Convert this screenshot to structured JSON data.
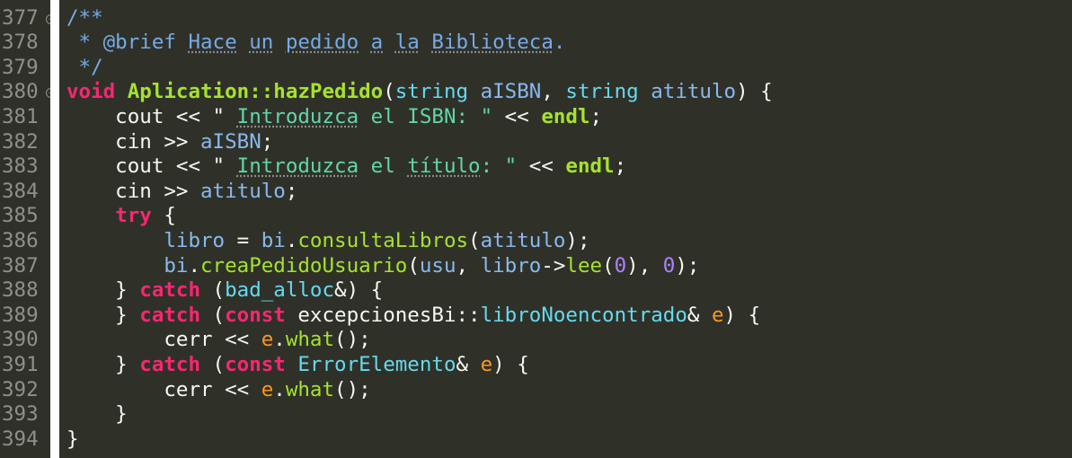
{
  "editor": {
    "lines": [
      {
        "number": "377",
        "fold": true,
        "tokens": [
          {
            "t": "/**",
            "c": "t-comment"
          }
        ]
      },
      {
        "number": "378",
        "fold": false,
        "tokens": [
          {
            "t": " * @brief ",
            "c": "t-comment"
          },
          {
            "t": "Hace",
            "c": "t-commentword"
          },
          {
            "t": " ",
            "c": "t-comment"
          },
          {
            "t": "un",
            "c": "t-commentword"
          },
          {
            "t": " ",
            "c": "t-comment"
          },
          {
            "t": "pedido",
            "c": "t-commentword"
          },
          {
            "t": " ",
            "c": "t-comment"
          },
          {
            "t": "a",
            "c": "t-commentword"
          },
          {
            "t": " ",
            "c": "t-comment"
          },
          {
            "t": "la",
            "c": "t-commentword"
          },
          {
            "t": " ",
            "c": "t-comment"
          },
          {
            "t": "Biblioteca",
            "c": "t-commentword"
          },
          {
            "t": ".",
            "c": "t-comment"
          }
        ]
      },
      {
        "number": "379",
        "fold": false,
        "tokens": [
          {
            "t": " */",
            "c": "t-comment"
          }
        ]
      },
      {
        "number": "380",
        "fold": true,
        "tokens": [
          {
            "t": "void",
            "c": "t-bold-keyword"
          },
          {
            "t": " ",
            "c": "t-plain"
          },
          {
            "t": "Aplication::hazPedido",
            "c": "t-bold-func"
          },
          {
            "t": "(",
            "c": "t-plain"
          },
          {
            "t": "string",
            "c": "t-type"
          },
          {
            "t": " ",
            "c": "t-plain"
          },
          {
            "t": "aISBN",
            "c": "t-ident"
          },
          {
            "t": ", ",
            "c": "t-plain"
          },
          {
            "t": "string",
            "c": "t-type"
          },
          {
            "t": " ",
            "c": "t-plain"
          },
          {
            "t": "atitulo",
            "c": "t-ident"
          },
          {
            "t": ") {",
            "c": "t-plain"
          }
        ]
      },
      {
        "number": "381",
        "fold": false,
        "tokens": [
          {
            "t": "    cout << \" ",
            "c": "t-plain"
          },
          {
            "t": "Introduzca",
            "c": "t-strword"
          },
          {
            "t": " el ISBN: \"",
            "c": "t-string"
          },
          {
            "t": " << ",
            "c": "t-plain"
          },
          {
            "t": "endl",
            "c": "t-bold-func"
          },
          {
            "t": ";",
            "c": "t-plain"
          }
        ]
      },
      {
        "number": "382",
        "fold": false,
        "tokens": [
          {
            "t": "    cin >> ",
            "c": "t-plain"
          },
          {
            "t": "aISBN",
            "c": "t-ident"
          },
          {
            "t": ";",
            "c": "t-plain"
          }
        ]
      },
      {
        "number": "383",
        "fold": false,
        "tokens": [
          {
            "t": "    cout << \" ",
            "c": "t-plain"
          },
          {
            "t": "Introduzca",
            "c": "t-strword"
          },
          {
            "t": " el ",
            "c": "t-string"
          },
          {
            "t": "título",
            "c": "t-strword"
          },
          {
            "t": ": \"",
            "c": "t-string"
          },
          {
            "t": " << ",
            "c": "t-plain"
          },
          {
            "t": "endl",
            "c": "t-bold-func"
          },
          {
            "t": ";",
            "c": "t-plain"
          }
        ]
      },
      {
        "number": "384",
        "fold": false,
        "tokens": [
          {
            "t": "    cin >> ",
            "c": "t-plain"
          },
          {
            "t": "atitulo",
            "c": "t-ident"
          },
          {
            "t": ";",
            "c": "t-plain"
          }
        ]
      },
      {
        "number": "385",
        "fold": false,
        "tokens": [
          {
            "t": "    ",
            "c": "t-plain"
          },
          {
            "t": "try",
            "c": "t-bold-keyword"
          },
          {
            "t": " {",
            "c": "t-plain"
          }
        ]
      },
      {
        "number": "386",
        "fold": false,
        "tokens": [
          {
            "t": "        ",
            "c": "t-plain"
          },
          {
            "t": "libro",
            "c": "t-ident"
          },
          {
            "t": " = ",
            "c": "t-plain"
          },
          {
            "t": "bi",
            "c": "t-ident"
          },
          {
            "t": ".",
            "c": "t-plain"
          },
          {
            "t": "consultaLibros",
            "c": "t-method"
          },
          {
            "t": "(",
            "c": "t-plain"
          },
          {
            "t": "atitulo",
            "c": "t-ident"
          },
          {
            "t": ");",
            "c": "t-plain"
          }
        ]
      },
      {
        "number": "387",
        "fold": false,
        "tokens": [
          {
            "t": "        ",
            "c": "t-plain"
          },
          {
            "t": "bi",
            "c": "t-ident"
          },
          {
            "t": ".",
            "c": "t-plain"
          },
          {
            "t": "creaPedidoUsuario",
            "c": "t-method"
          },
          {
            "t": "(",
            "c": "t-plain"
          },
          {
            "t": "usu",
            "c": "t-ident"
          },
          {
            "t": ", ",
            "c": "t-plain"
          },
          {
            "t": "libro",
            "c": "t-ident"
          },
          {
            "t": "->",
            "c": "t-plain"
          },
          {
            "t": "lee",
            "c": "t-method"
          },
          {
            "t": "(",
            "c": "t-plain"
          },
          {
            "t": "0",
            "c": "t-number"
          },
          {
            "t": "), ",
            "c": "t-plain"
          },
          {
            "t": "0",
            "c": "t-number"
          },
          {
            "t": ");",
            "c": "t-plain"
          }
        ]
      },
      {
        "number": "388",
        "fold": false,
        "tokens": [
          {
            "t": "    } ",
            "c": "t-plain"
          },
          {
            "t": "catch",
            "c": "t-bold-keyword"
          },
          {
            "t": " (",
            "c": "t-plain"
          },
          {
            "t": "bad_alloc",
            "c": "t-class"
          },
          {
            "t": "&) {",
            "c": "t-plain"
          }
        ]
      },
      {
        "number": "389",
        "fold": false,
        "tokens": [
          {
            "t": "    } ",
            "c": "t-plain"
          },
          {
            "t": "catch",
            "c": "t-bold-keyword"
          },
          {
            "t": " (",
            "c": "t-plain"
          },
          {
            "t": "const",
            "c": "t-bold-keyword"
          },
          {
            "t": " excepcionesBi::",
            "c": "t-plain"
          },
          {
            "t": "libroNoencontrado",
            "c": "t-class"
          },
          {
            "t": "& ",
            "c": "t-plain"
          },
          {
            "t": "e",
            "c": "t-param"
          },
          {
            "t": ") {",
            "c": "t-plain"
          }
        ]
      },
      {
        "number": "390",
        "fold": false,
        "tokens": [
          {
            "t": "        cerr << ",
            "c": "t-plain"
          },
          {
            "t": "e",
            "c": "t-param"
          },
          {
            "t": ".",
            "c": "t-plain"
          },
          {
            "t": "what",
            "c": "t-method"
          },
          {
            "t": "();",
            "c": "t-plain"
          }
        ]
      },
      {
        "number": "391",
        "fold": false,
        "tokens": [
          {
            "t": "    } ",
            "c": "t-plain"
          },
          {
            "t": "catch",
            "c": "t-bold-keyword"
          },
          {
            "t": " (",
            "c": "t-plain"
          },
          {
            "t": "const",
            "c": "t-bold-keyword"
          },
          {
            "t": " ",
            "c": "t-plain"
          },
          {
            "t": "ErrorElemento",
            "c": "t-class"
          },
          {
            "t": "& ",
            "c": "t-plain"
          },
          {
            "t": "e",
            "c": "t-param"
          },
          {
            "t": ") {",
            "c": "t-plain"
          }
        ]
      },
      {
        "number": "392",
        "fold": false,
        "tokens": [
          {
            "t": "        cerr << ",
            "c": "t-plain"
          },
          {
            "t": "e",
            "c": "t-param"
          },
          {
            "t": ".",
            "c": "t-plain"
          },
          {
            "t": "what",
            "c": "t-method"
          },
          {
            "t": "();",
            "c": "t-plain"
          }
        ]
      },
      {
        "number": "393",
        "fold": false,
        "tokens": [
          {
            "t": "    }",
            "c": "t-plain"
          }
        ]
      },
      {
        "number": "394",
        "fold": false,
        "tokens": [
          {
            "t": "}",
            "c": "t-plain"
          }
        ]
      }
    ]
  }
}
